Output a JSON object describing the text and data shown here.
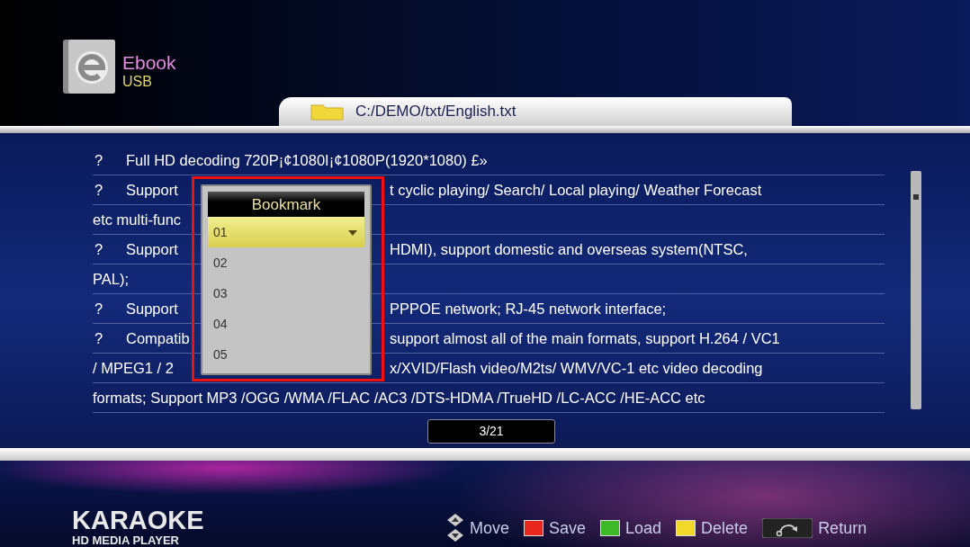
{
  "header": {
    "title": "Ebook",
    "source": "USB",
    "path": "C:/DEMO/txt/English.txt"
  },
  "lines": [
    {
      "bullet": "?",
      "left": "Full HD decoding 720P¡¢1080I¡¢1080P(1920*1080) £»"
    },
    {
      "bullet": "?",
      "left": "Support",
      "right": "t cyclic playing/ Search/ Local playing/ Weather Forecast"
    },
    {
      "left": "etc multi-func"
    },
    {
      "bullet": "?",
      "left": "Support",
      "right": "HDMI), support domestic and overseas system(NTSC,"
    },
    {
      "left": "PAL);"
    },
    {
      "bullet": "?",
      "left": "Support",
      "right": "PPPOE network; RJ-45 network interface;"
    },
    {
      "bullet": "?",
      "left": "Compatib",
      "right": "support almost all of the main formats, support H.264 / VC1"
    },
    {
      "left": " / MPEG1 / 2",
      "right": "x/XVID/Flash video/M2ts/ WMV/VC-1 etc video decoding"
    },
    {
      "left": "formats; Support MP3 /OGG /WMA /FLAC /AC3 /DTS-HDMA /TrueHD /LC-ACC /HE-ACC etc"
    }
  ],
  "bookmark": {
    "title": "Bookmark",
    "items": [
      {
        "label": "01",
        "selected": true
      },
      {
        "label": "02",
        "selected": false
      },
      {
        "label": "03",
        "selected": false
      },
      {
        "label": "04",
        "selected": false
      },
      {
        "label": "05",
        "selected": false
      }
    ]
  },
  "page": "3/21",
  "brand": {
    "name": "KARAOKE",
    "tagline": "HD MEDIA PLAYER"
  },
  "legend": [
    {
      "kind": "arrows",
      "label": "Move"
    },
    {
      "kind": "color",
      "color": "#e8281c",
      "label": "Save"
    },
    {
      "kind": "color",
      "color": "#3cb828",
      "label": "Load"
    },
    {
      "kind": "color",
      "color": "#f2d82a",
      "label": "Delete"
    },
    {
      "kind": "return",
      "label": "Return"
    }
  ]
}
